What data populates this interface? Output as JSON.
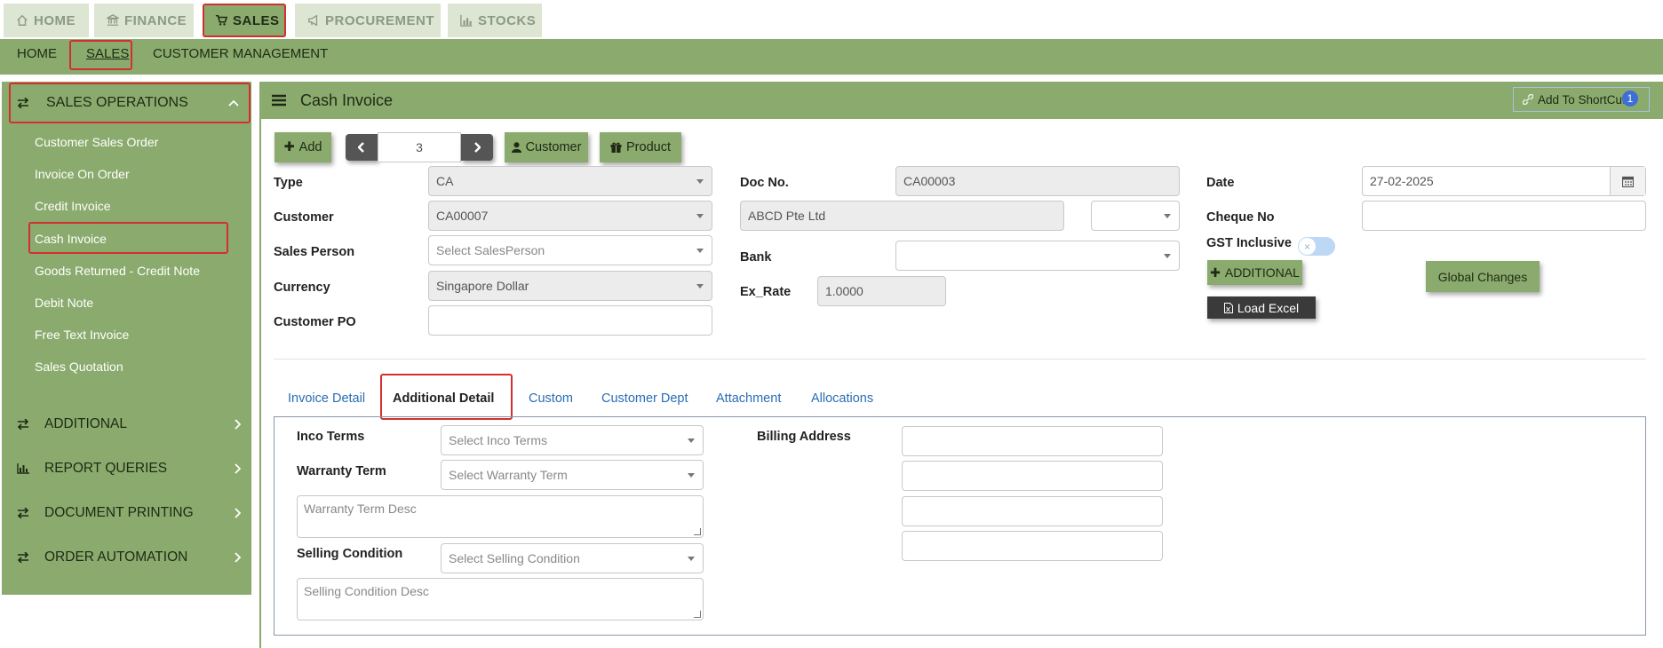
{
  "top_tabs": [
    {
      "label": "HOME",
      "icon": "home-icon"
    },
    {
      "label": "FINANCE",
      "icon": "bank-icon"
    },
    {
      "label": "SALES",
      "icon": "cart-icon"
    },
    {
      "label": "PROCUREMENT",
      "icon": "megaphone-icon"
    },
    {
      "label": "STOCKS",
      "icon": "chart-icon"
    }
  ],
  "subnav": [
    "HOME",
    "SALES",
    "CUSTOMER MANAGEMENT"
  ],
  "sidebar": {
    "section_title": "SALES OPERATIONS",
    "items": [
      "Customer Sales Order",
      "Invoice On Order",
      "Credit Invoice",
      "Cash Invoice",
      "Goods Returned - Credit Note",
      "Debit Note",
      "Free Text Invoice",
      "Sales Quotation"
    ],
    "sections": [
      "ADDITIONAL",
      "REPORT QUERIES",
      "DOCUMENT PRINTING",
      "ORDER AUTOMATION"
    ]
  },
  "header": {
    "title": "Cash Invoice",
    "shortcut_label": "Add To ShortCut",
    "shortcut_badge": "1"
  },
  "toolbar": {
    "add_label": "Add",
    "record_number": "3",
    "customer_label": "Customer",
    "product_label": "Product"
  },
  "form": {
    "type_label": "Type",
    "type_value": "CA",
    "customer_label": "Customer",
    "customer_value": "CA00007",
    "salesperson_label": "Sales Person",
    "salesperson_placeholder": "Select SalesPerson",
    "currency_label": "Currency",
    "currency_value": "Singapore Dollar",
    "customer_po_label": "Customer PO",
    "doc_no_label": "Doc No.",
    "doc_no_value": "CA00003",
    "customer_name_value": "ABCD Pte Ltd",
    "bank_label": "Bank",
    "ex_rate_label": "Ex_Rate",
    "ex_rate_value": "1.0000",
    "date_label": "Date",
    "date_value": "27-02-2025",
    "cheque_label": "Cheque No",
    "gst_label": "GST Inclusive",
    "additional_label": "ADDITIONAL",
    "load_excel_label": "Load Excel",
    "global_changes_label": "Global Changes"
  },
  "detail_tabs": [
    "Invoice Detail",
    "Additional Detail",
    "Custom",
    "Customer Dept",
    "Attachment",
    "Allocations"
  ],
  "additional_detail": {
    "inco_label": "Inco Terms",
    "inco_placeholder": "Select Inco Terms",
    "warranty_label": "Warranty Term",
    "warranty_placeholder": "Select Warranty Term",
    "warranty_desc_placeholder": "Warranty Term Desc",
    "selling_label": "Selling Condition",
    "selling_placeholder": "Select Selling Condition",
    "selling_desc_placeholder": "Selling Condition Desc",
    "billing_label": "Billing Address"
  },
  "colors": {
    "accent": "#8aab6d",
    "highlight": "#d32f2f",
    "tab_link": "#2a6db5"
  }
}
